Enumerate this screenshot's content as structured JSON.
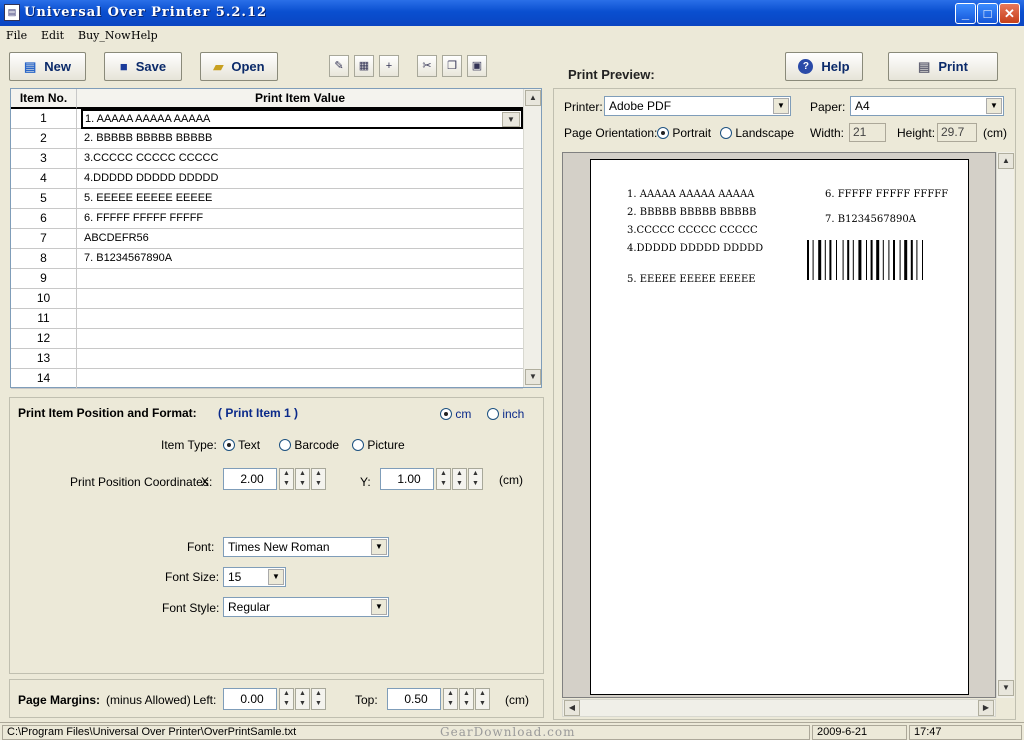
{
  "window": {
    "title": "Universal Over Printer 5.2.12",
    "icon": "app-icon",
    "min": "_",
    "max": "□",
    "close": "✕"
  },
  "menu": [
    "File",
    "Edit",
    "Buy_Now",
    "Help"
  ],
  "toolbar": {
    "new_label": "New",
    "save_label": "Save",
    "open_label": "Open"
  },
  "grid": {
    "headers": [
      "Item No.",
      "Print Item Value"
    ],
    "rows": [
      {
        "no": "1",
        "value": "1. AAAAA AAAAA AAAAA"
      },
      {
        "no": "2",
        "value": "2. BBBBB BBBBB BBBBB"
      },
      {
        "no": "3",
        "value": "3.CCCCC CCCCC CCCCC"
      },
      {
        "no": "4",
        "value": "4.DDDDD DDDDD DDDDD"
      },
      {
        "no": "5",
        "value": "5. EEEEE EEEEE EEEEE"
      },
      {
        "no": "6",
        "value": "6. FFFFF FFFFF FFFFF"
      },
      {
        "no": "7",
        "value": "ABCDEFR56"
      },
      {
        "no": "8",
        "value": "7. B1234567890A"
      },
      {
        "no": "9",
        "value": ""
      },
      {
        "no": "10",
        "value": ""
      },
      {
        "no": "11",
        "value": ""
      },
      {
        "no": "12",
        "value": ""
      },
      {
        "no": "13",
        "value": ""
      },
      {
        "no": "14",
        "value": ""
      }
    ]
  },
  "format": {
    "title": "Print Item Position and Format:",
    "current": "( Print Item 1 )",
    "unit_cm": "cm",
    "unit_inch": "inch",
    "item_type_label": "Item Type:",
    "types": [
      "Text",
      "Barcode",
      "Picture"
    ],
    "pos_label": "Print Position Coordinates",
    "x_label": "X:",
    "x_value": "2.00",
    "y_label": "Y:",
    "y_value": "1.00",
    "unit": "(cm)",
    "font_label": "Font:",
    "font_value": "Times New Roman",
    "size_label": "Font Size:",
    "size_value": "15",
    "style_label": "Font Style:",
    "style_value": "Regular"
  },
  "margins": {
    "title": "Page Margins:",
    "note": "(minus Allowed)",
    "left_label": "Left:",
    "left_value": "0.00",
    "top_label": "Top:",
    "top_value": "0.50",
    "unit": "(cm)"
  },
  "preview": {
    "title": "Print Preview:",
    "help_label": "Help",
    "print_label": "Print",
    "printer_label": "Printer:",
    "printer_value": "Adobe PDF",
    "paper_label": "Paper:",
    "paper_value": "A4",
    "orient_label": "Page Orientation:",
    "portrait": "Portrait",
    "landscape": "Landscape",
    "width_label": "Width:",
    "width_value": "21",
    "height_label": "Height:",
    "height_value": "29.7",
    "unit": "(cm)",
    "lines": [
      "1. AAAAA AAAAA AAAAA",
      "2. BBBBB BBBBB BBBBB",
      "3.CCCCC CCCCC CCCCC",
      "4.DDDDD DDDDD DDDDD",
      "5. EEEEE EEEEE EEEEE",
      "6. FFFFF FFFFF FFFFF",
      "7. B1234567890A"
    ]
  },
  "status": {
    "path": "C:\\Program Files\\Universal Over Printer\\OverPrintSamle.txt",
    "date": "2009-6-21",
    "time": "17:47",
    "watermark": "GearDownload.com"
  }
}
